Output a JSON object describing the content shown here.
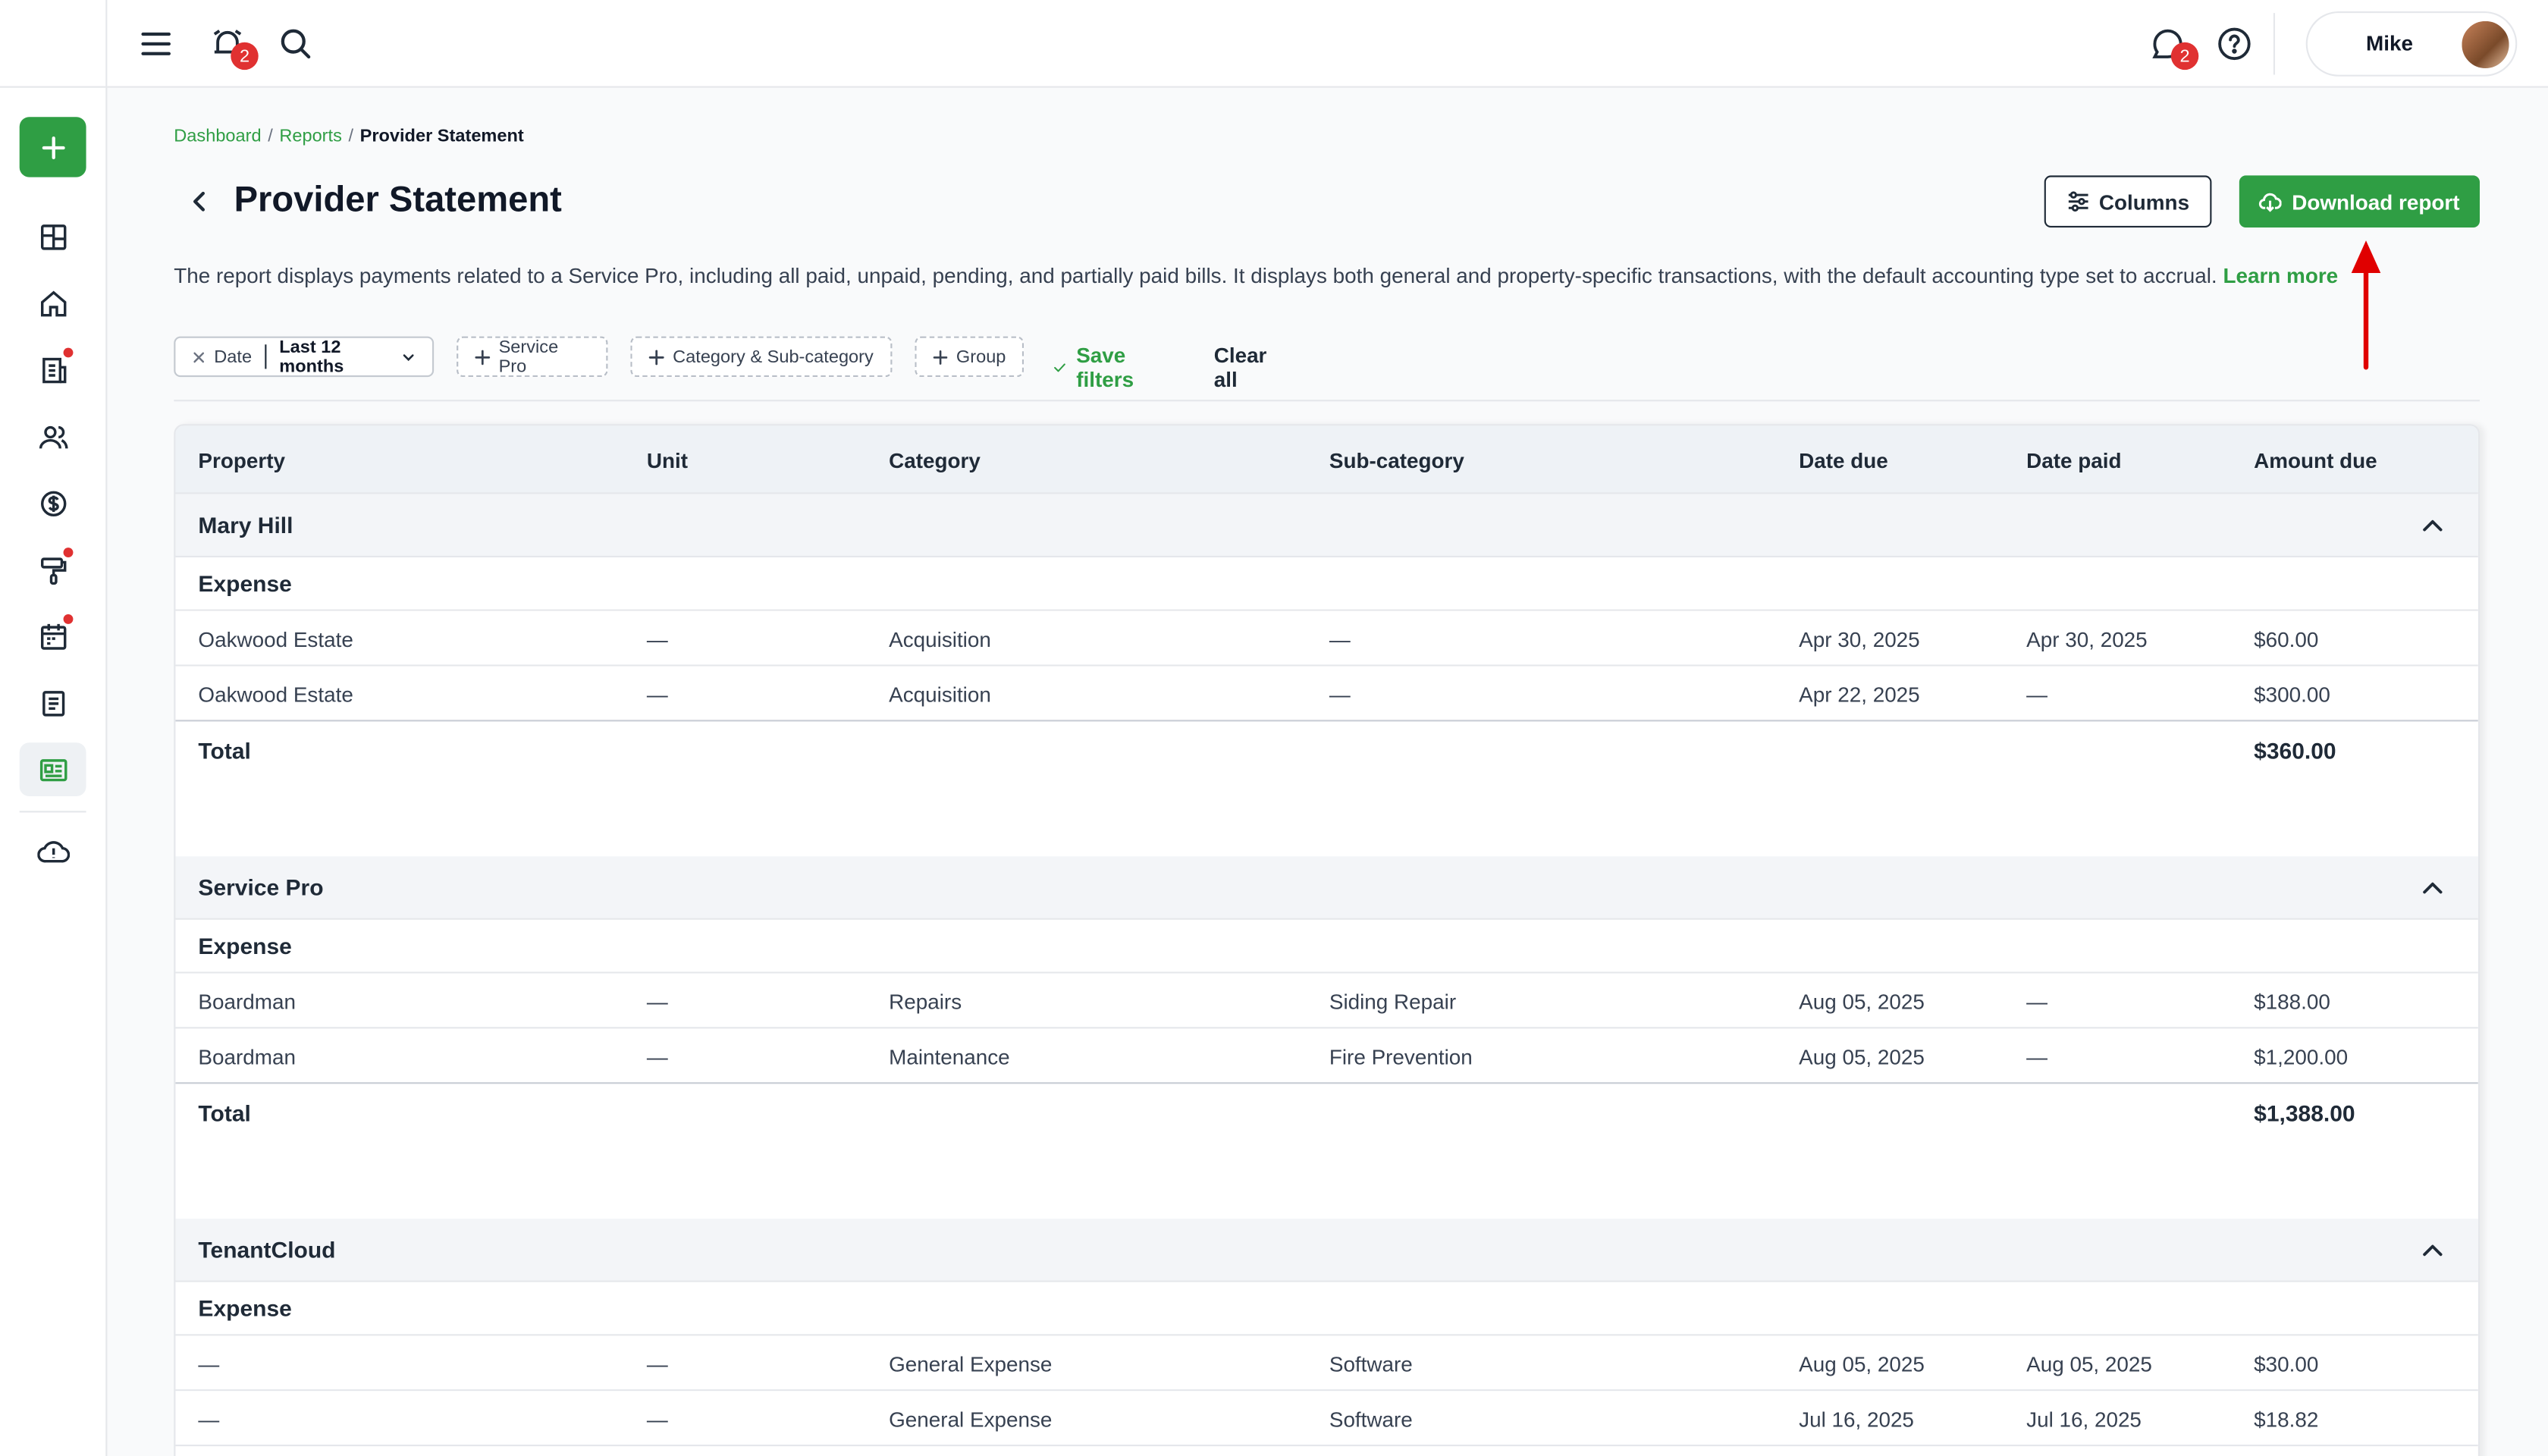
{
  "topbar": {
    "notifications_count": "2",
    "messages_count": "2",
    "user_name": "Mike"
  },
  "breadcrumb": {
    "items": [
      "Dashboard",
      "Reports"
    ],
    "current": "Provider Statement"
  },
  "page": {
    "title": "Provider Statement",
    "description": "The report displays payments related to a Service Pro, including all paid, unpaid, pending, and partially paid bills. It displays both general and property-specific transactions, with the default accounting type set to accrual.",
    "learn_more": "Learn more"
  },
  "actions": {
    "columns_label": "Columns",
    "download_label": "Download report"
  },
  "filters": {
    "date_label": "Date",
    "date_value": "Last 12 months",
    "service_pro": "Service Pro",
    "category": "Category & Sub-category",
    "group": "Group",
    "save_filters": "Save filters",
    "clear_all": "Clear all"
  },
  "table": {
    "columns": [
      "Property",
      "Unit",
      "Category",
      "Sub-category",
      "Date due",
      "Date paid",
      "Amount due"
    ],
    "groups": [
      {
        "name": "Mary Hill",
        "type": "Expense",
        "rows": [
          [
            "Oakwood Estate",
            "—",
            "Acquisition",
            "—",
            "Apr 30, 2025",
            "Apr 30, 2025",
            "$60.00"
          ],
          [
            "Oakwood Estate",
            "—",
            "Acquisition",
            "—",
            "Apr 22, 2025",
            "—",
            "$300.00"
          ]
        ],
        "total_label": "Total",
        "total": "$360.00"
      },
      {
        "name": "Service Pro",
        "type": "Expense",
        "rows": [
          [
            "Boardman",
            "—",
            "Repairs",
            "Siding Repair",
            "Aug 05, 2025",
            "—",
            "$188.00"
          ],
          [
            "Boardman",
            "—",
            "Maintenance",
            "Fire Prevention",
            "Aug 05, 2025",
            "—",
            "$1,200.00"
          ]
        ],
        "total_label": "Total",
        "total": "$1,388.00"
      },
      {
        "name": "TenantCloud",
        "type": "Expense",
        "rows": [
          [
            "—",
            "—",
            "General Expense",
            "Software",
            "Aug 05, 2025",
            "Aug 05, 2025",
            "$30.00"
          ],
          [
            "—",
            "—",
            "General Expense",
            "Software",
            "Jul 16, 2025",
            "Jul 16, 2025",
            "$18.82"
          ]
        ]
      }
    ]
  },
  "colors": {
    "accent": "#2f9e44",
    "badge": "#e03131",
    "annotation_arrow": "#e00000"
  }
}
